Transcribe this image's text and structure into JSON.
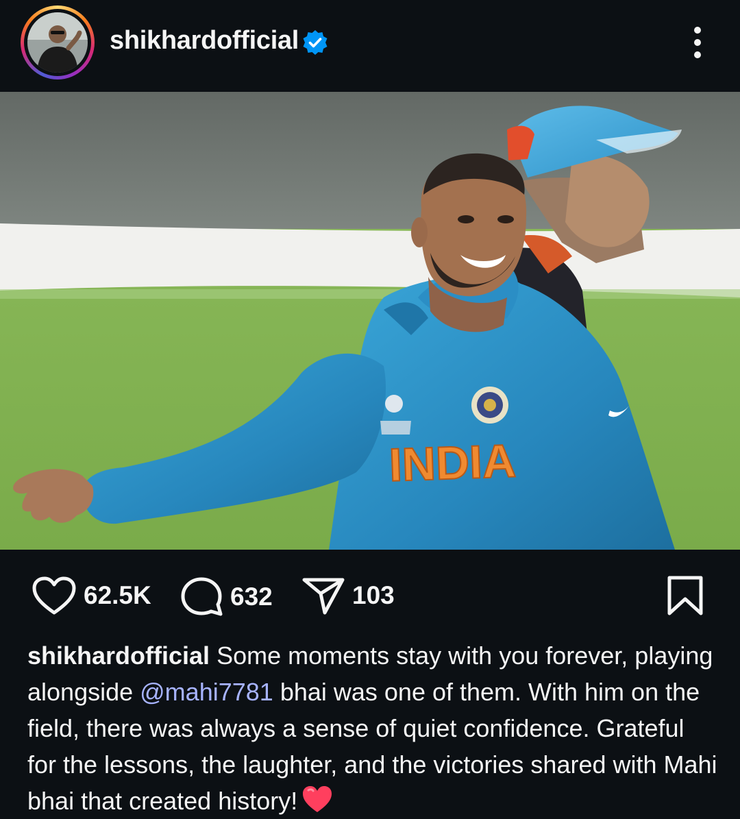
{
  "post": {
    "username": "shikhardofficial",
    "verified": true,
    "avatar_icon": "profile-photo",
    "image_alt": "Two cricketers in India team kits laughing on the field",
    "jersey_text": "INDIA"
  },
  "actions": {
    "likes": "62.5K",
    "comments": "632",
    "shares": "103"
  },
  "caption": {
    "username": "shikhardofficial",
    "text_1": " Some moments stay with you forever, playing alongside ",
    "mention": "@mahi7781",
    "text_2": " bhai was one of them. With him on the field, there was always a sense of quiet confidence. Grateful for the lessons, the laughter, and the victories shared with Mahi bhai that created history!",
    "emoji": "red-heart-emoji"
  },
  "colors": {
    "background": "#0c1014",
    "text": "#f5f5f5",
    "mention": "#a7b3ff",
    "verified_blue": "#0095f6",
    "heart_red": "#ff3040"
  }
}
